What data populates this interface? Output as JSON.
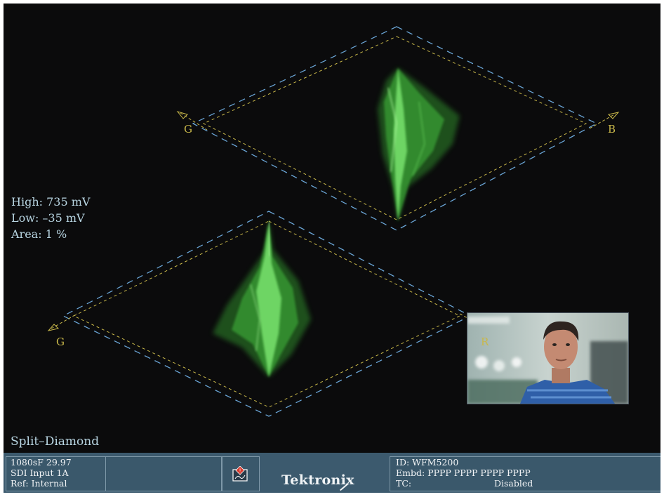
{
  "readouts": {
    "high": "High: 735 mV",
    "low": "Low: –35 mV",
    "area": "Area:   1 %"
  },
  "diamond_labels": {
    "top_left": "G",
    "top_right": "B",
    "bottom_left": "G",
    "bottom_right": "R"
  },
  "display_mode": "Split–Diamond",
  "status": {
    "format": "1080sF 29.97",
    "input": "SDI Input 1A",
    "ref": "Ref: Internal",
    "alarm_icon": "alarm-warning-icon",
    "brand": "Tektronix",
    "id": "ID: WFM5200",
    "embd": "Embd: PPPP PPPP PPPP PPPP",
    "tc_label": "TC:",
    "tc_value": "Disabled"
  },
  "colors": {
    "trace": "#4fcf4a",
    "graticule_outer": "#6aa5d6",
    "graticule_inner": "#c9b84a",
    "statusbar": "#3c5a6e"
  }
}
